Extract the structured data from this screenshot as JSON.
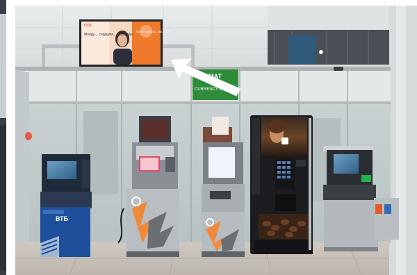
{
  "photo": {
    "billboard": {
      "left_text": "Монду… сердцем… переводы",
      "right_text": "Так же просто, как… по-…",
      "brand": "ПСБ"
    },
    "exchange_sign": {
      "line1": "МАТ",
      "line2": "CURRENCY EX…"
    },
    "atm_vtb": {
      "brand": "ВТБ"
    }
  },
  "colors": {
    "billboard_orange": "#f07a2c",
    "sign_green": "#2e8b3a",
    "vtb_blue": "#1d4f9a",
    "coffee_dark": "#2a1f1a",
    "arrow_white": "#ffffff"
  },
  "icons": {
    "pointer": "arrow-icon"
  }
}
